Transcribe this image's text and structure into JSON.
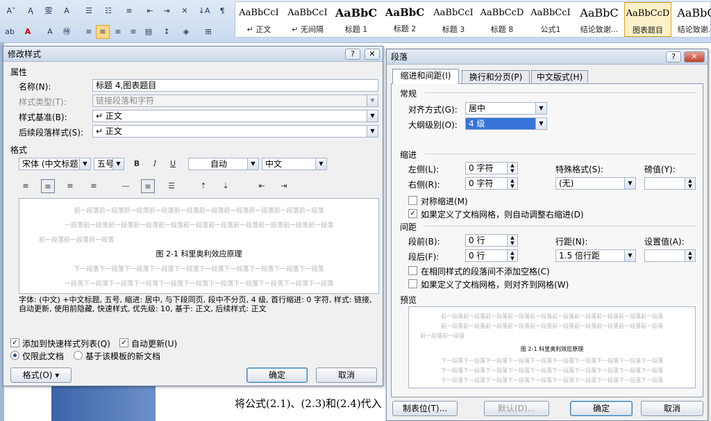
{
  "ribbon": {
    "gallery": [
      {
        "sample": "AaBbCcI",
        "name": "↵ 正文"
      },
      {
        "sample": "AaBbCcI",
        "name": "↵ 无间隔"
      },
      {
        "sample": "AaBbC",
        "name": "标题 1"
      },
      {
        "sample": "AaBbC",
        "name": "标题 2"
      },
      {
        "sample": "AaBbCcI",
        "name": "标题 3"
      },
      {
        "sample": "AaBbCcD",
        "name": "标题 8"
      },
      {
        "sample": "AaBbCcI",
        "name": "公式1"
      },
      {
        "sample": "AaBbC",
        "name": "结论致谢..."
      },
      {
        "sample": "AaBbCcD",
        "name": "图表题目"
      },
      {
        "sample": "AaBbC",
        "name": "结论致谢..."
      }
    ]
  },
  "document": {
    "body_text": "将公式(2.1)、(2.3)和(2.4)代入"
  },
  "modify_style": {
    "title": "修改样式",
    "help": "?",
    "close": "✕",
    "properties_header": "属性",
    "name_label": "名称(N):",
    "name_value": "标题 4,图表题目",
    "type_label": "样式类型(T):",
    "type_value": "链接段落和字符",
    "based_label": "样式基准(B):",
    "based_value": "↵ 正文",
    "following_label": "后续段落样式(S):",
    "following_value": "↵ 正文",
    "format_header": "格式",
    "font": "宋体 (中文标题)",
    "size": "五号",
    "bold": "B",
    "italic": "I",
    "underline": "U",
    "color": "自动",
    "script": "中文",
    "preview_before": [
      "前一段落前一段落前一段落前一段落前一段落前一段落前一段落前一段落前一段落前一段落",
      "一段落前一段落前一段落前一段落前一段落前一段落前一段落前一段落前一段落前一段落前一段落",
      "前一段落前一段落前一段落"
    ],
    "preview_sample": "图 2-1 科里奥利效应原理",
    "preview_after": [
      "下一段落下一段落下一段落下一段落下一段落下一段落下一段落下一段落下一段落下一段落",
      "一段落下一段落下一段落下一段落下一段落下一段落下一段落下一段落下一段落下一段落下一段落"
    ],
    "description": "字体: (中文) +中文标题, 五号, 缩进: 居中, 与下段同页, 段中不分页, 4 级, 首行缩进: 0 字符, 样式: 链接, 自动更新, 使用前隐藏, 快速样式, 优先级: 10, 基于: 正文, 后续样式: 正文",
    "add_quick": "添加到快速样式列表(Q)",
    "auto_update": "自动更新(U)",
    "only_doc": "仅限此文档",
    "new_template": "基于该模板的新文档",
    "format_btn": "格式(O) ▾",
    "ok": "确定",
    "cancel": "取消"
  },
  "paragraph": {
    "title": "段落",
    "help": "?",
    "close": "✕",
    "tabs": [
      "缩进和间距(I)",
      "换行和分页(P)",
      "中文版式(H)"
    ],
    "general_header": "常规",
    "align_label": "对齐方式(G):",
    "align_value": "居中",
    "outline_label": "大纲级别(O):",
    "outline_value": "4 级",
    "indent_header": "缩进",
    "left_label": "左侧(L):",
    "left_value": "0 字符",
    "right_label": "右侧(R):",
    "right_value": "0 字符",
    "special_label": "特殊格式(S):",
    "special_value": "(无)",
    "by_label": "磅值(Y):",
    "mirror": "对称缩进(M)",
    "auto_right": "如果定义了文档网格，则自动调整右缩进(D)",
    "spacing_header": "间距",
    "before_label": "段前(B):",
    "before_value": "0 行",
    "after_label": "段后(F):",
    "after_value": "0 行",
    "line_label": "行距(N):",
    "line_value": "1.5 倍行距",
    "at_label": "设置值(A):",
    "no_space": "在相同样式的段落间不添加空格(C)",
    "snap_grid": "如果定义了文档网格，则对齐到网格(W)",
    "preview_header": "预览",
    "preview_before": [
      "前一段落前一段落前一段落前一段落前一段落前一段落前一段落前一段落前一段落前一段落",
      "前一段落前一段落前一段落前一段落前一段落前一段落前一段落前一段落前一段落前一段落",
      "前一段落前一段落"
    ],
    "preview_sample": "图 2-1  科里奥利效应原理",
    "preview_after": [
      "下一段落下一段落下一段落下一段落下一段落下一段落下一段落下一段落下一段落下一段落",
      "下一段落下一段落下一段落下一段落下一段落下一段落下一段落下一段落下一段落下一段落",
      "下一段落下一段落下一段落下一段落下一段落下一段落下一段落下一段落下一段落下一段落"
    ],
    "tabs_btn": "制表位(T)...",
    "default_btn": "默认(D)...",
    "ok": "确定",
    "cancel": "取消"
  }
}
